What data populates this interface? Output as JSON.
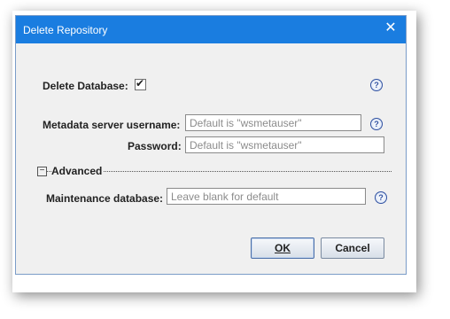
{
  "window": {
    "title": "Delete Repository",
    "close_glyph": "✕"
  },
  "form": {
    "delete_database": {
      "label": "Delete Database:",
      "checked": true,
      "check_glyph": "✔"
    },
    "metadata_username": {
      "label": "Metadata server username:",
      "placeholder": "Default is \"wsmetauser\""
    },
    "password": {
      "label": "Password:",
      "placeholder": "Default is \"wsmetauser\""
    },
    "advanced": {
      "label": "Advanced",
      "toggle_glyph": "−"
    },
    "maintenance_database": {
      "label": "Maintenance database:",
      "placeholder": "Leave blank for default"
    },
    "help_glyph": "?"
  },
  "buttons": {
    "ok": "OK",
    "cancel": "Cancel"
  },
  "colors": {
    "titlebar": "#1a7de0",
    "dialog_bg": "#f0f0f0"
  }
}
